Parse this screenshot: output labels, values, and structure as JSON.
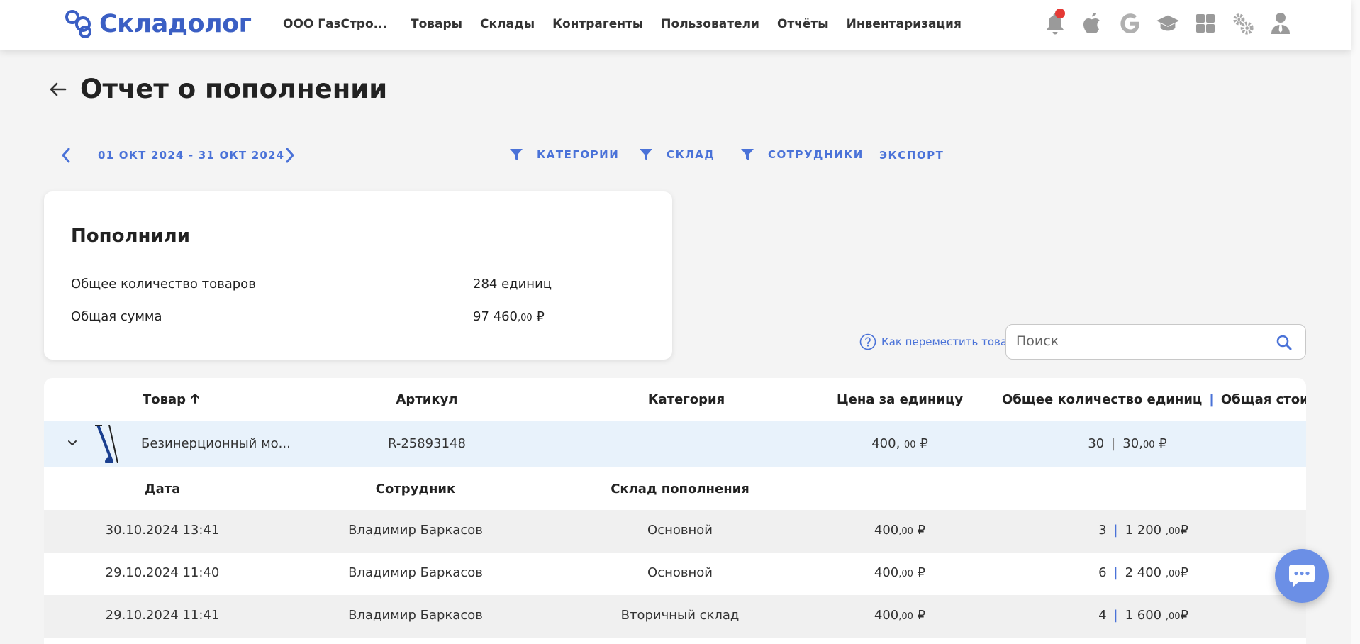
{
  "app": {
    "logo_text": "Складолог",
    "company": "ООО ГазСтро..."
  },
  "nav": [
    "Товары",
    "Склады",
    "Контрагенты",
    "Пользователи",
    "Отчёты",
    "Инвентаризация"
  ],
  "header_icons": [
    "bell-icon",
    "apple-icon",
    "google-icon",
    "graduation-cap-icon",
    "grid-icon",
    "gears-icon",
    "user-tie-icon"
  ],
  "page": {
    "title": "Отчет о пополнении"
  },
  "toolbar": {
    "date_range": "01 ОКТ 2024 - 31 ОКТ 2024",
    "filter_categories": "КАТЕГОРИИ",
    "filter_warehouse": "СКЛАД",
    "filter_employees": "СОТРУДНИКИ",
    "export": "ЭКСПОРТ"
  },
  "summary": {
    "title": "Пополнили",
    "total_qty_label": "Общее количество товаров",
    "total_qty_value": "284 единиц",
    "total_sum_label": "Общая сумма",
    "total_sum_main": "97 460",
    "total_sum_cents": ",00",
    "currency": "₽"
  },
  "help": {
    "label": "Как переместить товар"
  },
  "search": {
    "placeholder": "Поиск",
    "value": ""
  },
  "table": {
    "headers": {
      "product": "Товар",
      "sku": "Артикул",
      "category": "Категория",
      "unit_price": "Цена за единицу",
      "total_qty": "Общее количество единиц",
      "separator": "|",
      "total_cost": "Общая стоимость"
    },
    "product_row": {
      "name": "Безинерционный мо...",
      "sku": "R-25893148",
      "category": "",
      "price_main": "400,",
      "price_cents": "00",
      "qty": "30",
      "cost_main": "30,",
      "cost_cents": "00",
      "currency": "₽"
    },
    "sub_headers": {
      "date": "Дата",
      "employee": "Сотрудник",
      "warehouse": "Склад пополнения"
    },
    "sub_rows": [
      {
        "date": "30.10.2024 13:41",
        "employee": "Владимир Баркасов",
        "warehouse": "Основной",
        "price_main": "400",
        "price_cents": ",00",
        "qty": "3",
        "cost_main": "1 200",
        "cost_cents": ",00"
      },
      {
        "date": "29.10.2024 11:40",
        "employee": "Владимир Баркасов",
        "warehouse": "Основной",
        "price_main": "400",
        "price_cents": ",00",
        "qty": "6",
        "cost_main": "2 400",
        "cost_cents": ",00"
      },
      {
        "date": "29.10.2024 11:41",
        "employee": "Владимир Баркасов",
        "warehouse": "Вторичный склад",
        "price_main": "400",
        "price_cents": ",00",
        "qty": "4",
        "cost_main": "1 600",
        "cost_cents": ",00"
      }
    ]
  },
  "colors": {
    "accent": "#4a72d8",
    "brand": "#3b5fc4",
    "row_highlight": "#e8f2fb",
    "notification": "#e53935"
  }
}
